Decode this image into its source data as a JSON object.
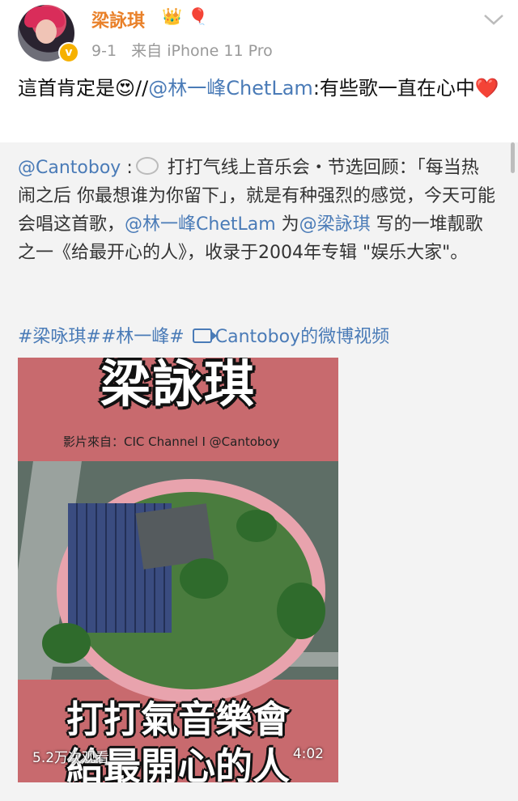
{
  "post": {
    "username": "梁詠琪",
    "badges": [
      "👑",
      "🎈"
    ],
    "date": "9-1",
    "source": "来自 iPhone 11 Pro",
    "text_part1": "這首肯定是",
    "emoji_heart_eyes": "😍",
    "slashes": "//",
    "mention": "@林一峰ChetLam",
    "text_part2": ":有些歌一直在心中",
    "heart": "❤️"
  },
  "repost": {
    "author": "@Cantoboy",
    "colon": " :",
    "text1": " 打打气线上音乐会・节选回顾：「每当热闹之后 你最想谁为你留下」，就是有种强烈的感觉，今天可能会唱这首歌，",
    "mention1": "@林一峰ChetLam",
    "text2": " 为",
    "mention2": "@梁詠琪",
    "text3": " 写的一堆靓歌之一《给最开心的人》，收录于2004年专辑 \"娱乐大家\"。",
    "tags": "#梁咏琪##林一峰#",
    "video_link": "Cantoboy的微博视频"
  },
  "video": {
    "top_title": "梁詠琪",
    "source_line": "影片來自：CIC Channel I @Cantoboy",
    "bottom_title": "打打氣音樂會",
    "bottom_title2": "給最開心的人",
    "views": "5.2万次观看",
    "duration": "4:02"
  },
  "colors": {
    "username": "#e9812a",
    "link": "#4a7bb7",
    "video_bg": "#c86a6e"
  },
  "icons": [
    "avatar",
    "verified-icon",
    "crown-icon",
    "balloon-icon",
    "chevron-down-icon",
    "comment-bubble-icon",
    "video-icon"
  ]
}
